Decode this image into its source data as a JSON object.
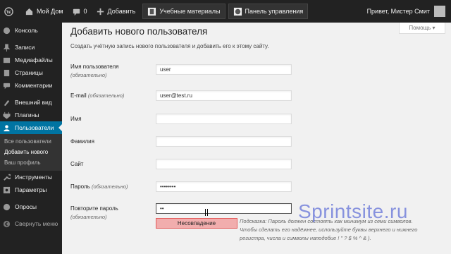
{
  "adminbar": {
    "site_name": "Мой Дом",
    "comments_count": "0",
    "add_new": "Добавить",
    "link1": "Учебные материалы",
    "link2": "Панель управления",
    "greeting": "Привет, Мистер Смит"
  },
  "sidebar": {
    "items": [
      {
        "label": "Консоль",
        "icon": "dashboard-icon"
      },
      {
        "label": "Записи",
        "icon": "pin-icon"
      },
      {
        "label": "Медиафайлы",
        "icon": "media-icon"
      },
      {
        "label": "Страницы",
        "icon": "pages-icon"
      },
      {
        "label": "Комментарии",
        "icon": "comments-icon"
      },
      {
        "label": "Внешний вид",
        "icon": "appearance-icon"
      },
      {
        "label": "Плагины",
        "icon": "plugins-icon"
      },
      {
        "label": "Пользователи",
        "icon": "users-icon"
      },
      {
        "label": "Инструменты",
        "icon": "tools-icon"
      },
      {
        "label": "Параметры",
        "icon": "settings-icon"
      },
      {
        "label": "Опросы",
        "icon": "polls-icon"
      },
      {
        "label": "Свернуть меню",
        "icon": "collapse-icon"
      }
    ],
    "submenu": [
      "Все пользователи",
      "Добавить нового",
      "Ваш профиль"
    ]
  },
  "help_button": "Помощь ▾",
  "page": {
    "title": "Добавить нового пользователя",
    "description": "Создать учётную запись нового пользователя и добавить его к этому сайту."
  },
  "form": {
    "username_label": "Имя пользователя",
    "required": "(обязательно)",
    "username_value": "user",
    "email_label": "E-mail",
    "email_value": "user@test.ru",
    "first_name_label": "Имя",
    "last_name_label": "Фамилия",
    "website_label": "Сайт",
    "password_label": "Пароль",
    "password_value": "••••••••",
    "repeat_label": "Повторите пароль",
    "repeat_value": "••",
    "strength": "Несовпадение",
    "hint": "Подсказка: Пароль должен состоять как минимум из семи символов. Чтобы сделать его надёжнее, используйте буквы верхнего и нижнего регистра, числа и символы наподобие ! \" ? $ % ^ & )."
  },
  "watermark": "Sprintsite.ru",
  "colors": {
    "accent": "#0074a2",
    "adminbar": "#222222",
    "mismatch_bg": "#f1adad"
  }
}
